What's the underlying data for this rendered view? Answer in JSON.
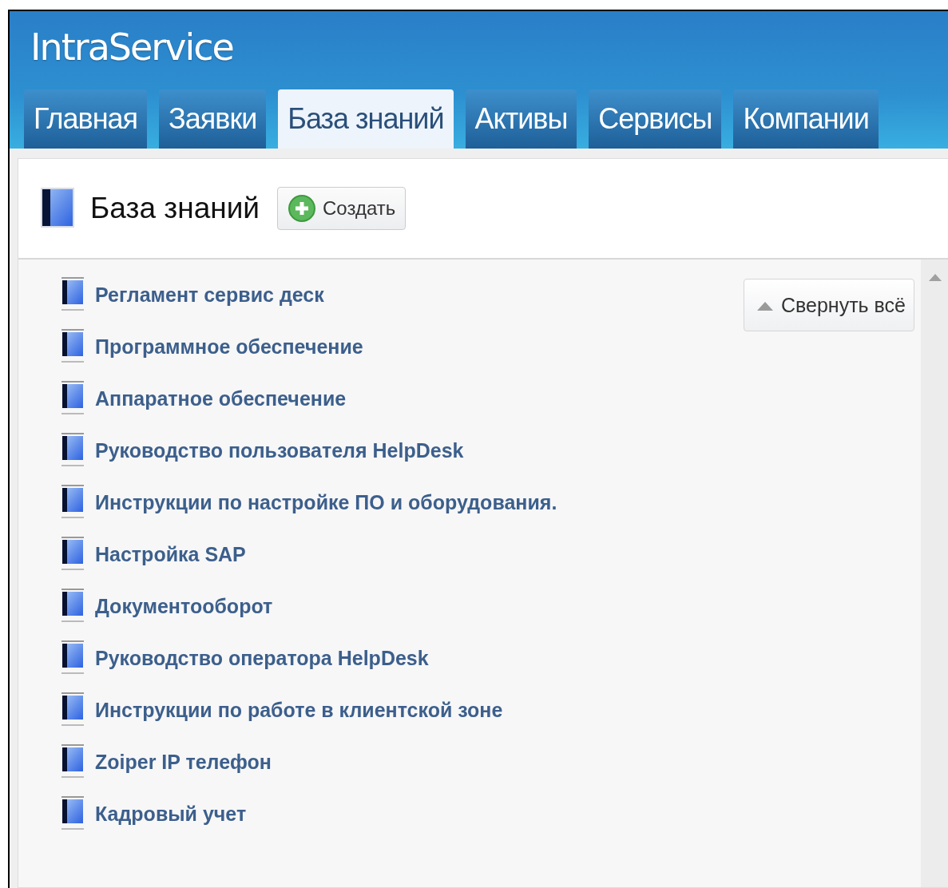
{
  "header": {
    "logo": "IntraService"
  },
  "tabs": [
    {
      "label": "Главная",
      "selected": false
    },
    {
      "label": "Заявки",
      "selected": false
    },
    {
      "label": "База знаний",
      "selected": true
    },
    {
      "label": "Активы",
      "selected": false
    },
    {
      "label": "Сервисы",
      "selected": false
    },
    {
      "label": "Компании",
      "selected": false
    }
  ],
  "page": {
    "title": "База знаний",
    "create_button": "Создать"
  },
  "collapse_button": "Свернуть всё",
  "tree": [
    {
      "label": "Регламент сервис деск"
    },
    {
      "label": "Программное обеспечение"
    },
    {
      "label": "Аппаратное обеспечение"
    },
    {
      "label": "Руководство пользователя HelpDesk"
    },
    {
      "label": "Инструкции по настройке ПО и оборудования."
    },
    {
      "label": "Настройка SAP"
    },
    {
      "label": "Документооборот"
    },
    {
      "label": "Руководство оператора HelpDesk"
    },
    {
      "label": "Инструкции по работе в клиентской зоне"
    },
    {
      "label": "Zoiper IP телефон"
    },
    {
      "label": "Кадровый учет"
    }
  ]
}
